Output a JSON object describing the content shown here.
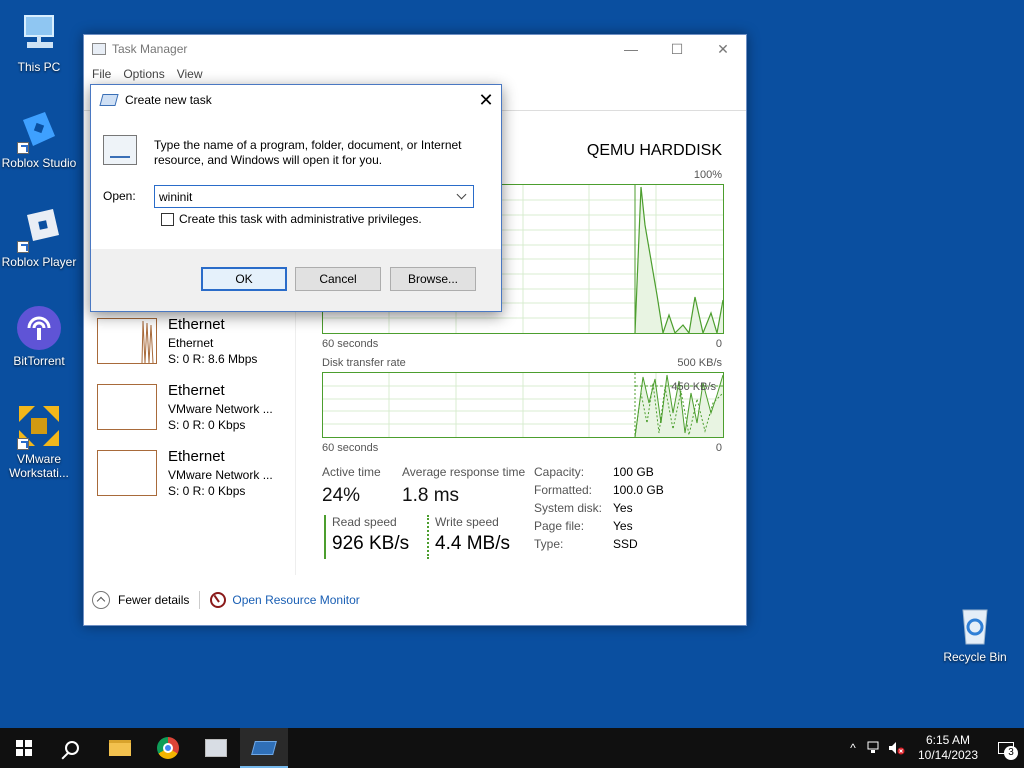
{
  "desktop": {
    "icons": [
      {
        "label": "This PC"
      },
      {
        "label": "Roblox Studio"
      },
      {
        "label": "Roblox Player"
      },
      {
        "label": "BitTorrent"
      },
      {
        "label": "VMware Workstati..."
      },
      {
        "label": "Recycle Bin"
      }
    ]
  },
  "taskmanager": {
    "title": "Task Manager",
    "controls": {
      "minimize": "—",
      "maximize": "☐",
      "close": "✕"
    },
    "menu": [
      "File",
      "Options",
      "View"
    ],
    "ethernet": [
      {
        "title": "Ethernet",
        "sub": "Ethernet",
        "stat": "S: 0 R: 8.6 Mbps"
      },
      {
        "title": "Ethernet",
        "sub": "VMware Network ...",
        "stat": "S: 0 R: 0 Kbps"
      },
      {
        "title": "Ethernet",
        "sub": "VMware Network ...",
        "stat": "S: 0 R: 0 Kbps"
      }
    ],
    "disk": {
      "name": "QEMU HARDDISK",
      "activity_graph": {
        "top_label": "100%",
        "left_label": "60 seconds",
        "right_label": "0"
      },
      "transfer_graph": {
        "title": "Disk transfer rate",
        "top_label": "500 KB/s",
        "mid_label": "450 KB/s",
        "left_label": "60 seconds",
        "right_label": "0"
      },
      "active_time_label": "Active time",
      "active_time": "24%",
      "avg_response_label": "Average response time",
      "avg_response": "1.8 ms",
      "read_speed_label": "Read speed",
      "read_speed": "926 KB/s",
      "write_speed_label": "Write speed",
      "write_speed": "4.4 MB/s",
      "props": [
        {
          "k": "Capacity:",
          "v": "100 GB"
        },
        {
          "k": "Formatted:",
          "v": "100.0 GB"
        },
        {
          "k": "System disk:",
          "v": "Yes"
        },
        {
          "k": "Page file:",
          "v": "Yes"
        },
        {
          "k": "Type:",
          "v": "SSD"
        }
      ]
    },
    "footer": {
      "fewer_details": "Fewer details",
      "resource_monitor": "Open Resource Monitor"
    }
  },
  "run_dialog": {
    "title": "Create new task",
    "close": "✕",
    "description": "Type the name of a program, folder, document, or Internet resource, and Windows will open it for you.",
    "open_label": "Open:",
    "open_value": "wininit",
    "admin_checkbox": "Create this task with administrative privileges.",
    "ok": "OK",
    "cancel": "Cancel",
    "browse": "Browse..."
  },
  "taskbar": {
    "clock_time": "6:15 AM",
    "clock_date": "10/14/2023",
    "notification_count": "3",
    "tray_chevron": "^"
  },
  "colors": {
    "desktop": "#0a4fa0",
    "graph_green": "#4c9e2e",
    "link_blue": "#1a5fb4",
    "accent": "#2a6cc9"
  }
}
